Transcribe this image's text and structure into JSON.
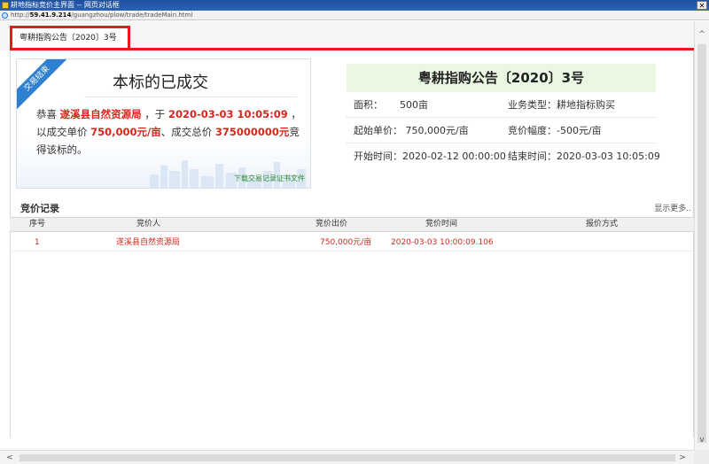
{
  "window": {
    "title": "耕地指标竞价主界面 -- 网页对话框",
    "close_glyph": "✕",
    "url_prefix": "http://",
    "url_host": "59.41.9.214",
    "url_path": "/guangzhou/plow/trade/tradeMain.html"
  },
  "tab": {
    "label": "粤耕指购公告〔2020〕3号"
  },
  "card": {
    "ribbon": "交易结束",
    "title": "本标的已成交",
    "text_1": "恭喜 ",
    "winner": "遂溪县自然资源局",
    "text_2": " ，于 ",
    "deal_time": "2020-03-03 10:05:09",
    "text_3": " ，以成交单价 ",
    "unit_price": "750,000元/亩",
    "text_4": "、成交总价 ",
    "total_price": "375000000元",
    "text_5": "竞得该标的。",
    "download_link": "下载交易记录证书文件"
  },
  "info": {
    "title": "粤耕指购公告〔2020〕3号",
    "area_label": "面积：",
    "area_value": "500亩",
    "business_type": "业务类型：耕地指标购买",
    "start_price": "起始单价：  750,000元/亩",
    "increment": "竞价幅度：-500元/亩",
    "start_time": "开始时间：2020-02-12 00:00:00",
    "end_time": "结束时间：2020-03-03 10:05:09"
  },
  "records": {
    "title": "竞价记录",
    "more": "显示更多..",
    "columns": [
      "序号",
      "竞价人",
      "竞价出价",
      "竞价时间",
      "报价方式"
    ],
    "rows": [
      {
        "no": "1",
        "bidder": "遂溪县自然资源局",
        "price": "750,000元/亩",
        "time": "2020-03-03 10:00:09.106",
        "method": ""
      }
    ]
  },
  "colors": {
    "accent_red": "#e51c1c",
    "highlight_red": "#d9261c",
    "header_green": "#eaf8e3",
    "ribbon_blue": "#2f80d1"
  },
  "scroll": {
    "up": "^",
    "down": "v",
    "left": "<",
    "right": ">"
  }
}
